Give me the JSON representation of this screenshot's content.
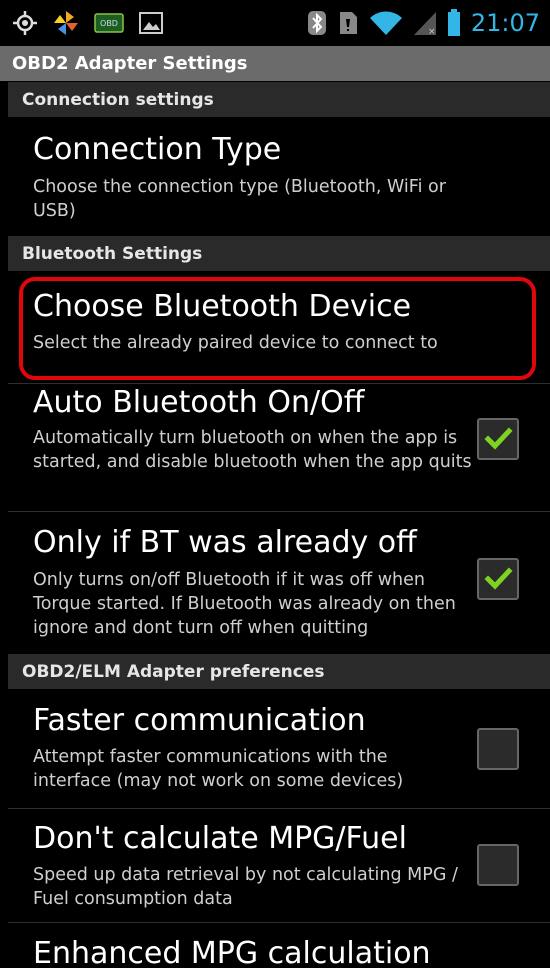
{
  "status_bar": {
    "time": "21:07",
    "icons": [
      "gps-icon",
      "pinwheel-app-icon",
      "obd-app-icon",
      "picture-icon",
      "bluetooth-icon",
      "sim-card-icon",
      "wifi-icon",
      "signal-icon",
      "battery-icon"
    ],
    "obd_icon_text": "OBD"
  },
  "app_bar": {
    "title": "OBD2 Adapter Settings"
  },
  "sections": {
    "connection": "Connection settings",
    "bluetooth": "Bluetooth Settings",
    "adapter": "OBD2/ELM Adapter preferences"
  },
  "prefs": {
    "connection_type": {
      "title": "Connection Type",
      "summary": "Choose the connection type (Bluetooth, WiFi or USB)"
    },
    "choose_bt_device": {
      "title": "Choose Bluetooth Device",
      "summary": "Select the already paired device to connect to"
    },
    "auto_bt": {
      "title": "Auto Bluetooth On/Off",
      "summary": "Automatically turn bluetooth on when the app is started, and disable bluetooth when the app quits",
      "checked": true
    },
    "only_if_bt_off": {
      "title": "Only if BT was already off",
      "summary": "Only turns on/off Bluetooth if it was off when Torque started. If Bluetooth was already on then ignore and dont turn off when quitting",
      "checked": true
    },
    "faster_comm": {
      "title": "Faster communication",
      "summary": "Attempt faster communications with the interface (may not work on some devices)",
      "checked": false
    },
    "no_mpg": {
      "title": "Don't calculate MPG/Fuel",
      "summary": "Speed up data retrieval by not calculating MPG / Fuel consumption data",
      "checked": false
    },
    "enhanced_mpg": {
      "title": "Enhanced MPG calculation"
    }
  },
  "colors": {
    "accent": "#33b5e5",
    "highlight": "#e1060b",
    "check": "#7ed321"
  }
}
